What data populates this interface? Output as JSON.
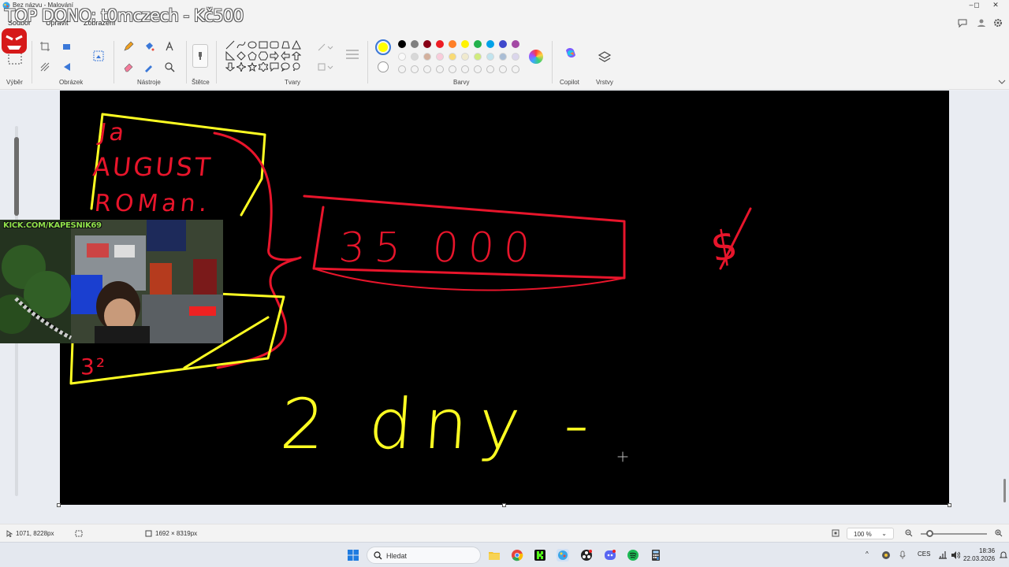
{
  "window": {
    "title": "Bez názvu - Malování",
    "controls": [
      "–",
      "◻",
      "✕"
    ]
  },
  "overlay": {
    "donor_text": "TOP DONO: t0mczech - Kč500",
    "webcam_label": "KICK.COM/KAPESNIK69"
  },
  "menu": {
    "items": [
      "Soubor",
      "Upravit",
      "Zobrazení"
    ]
  },
  "ribbon": {
    "groups": {
      "selection": "Výběr",
      "image": "Obrázek",
      "tools": "Nástroje",
      "brushes": "Štětce",
      "shapes": "Tvary",
      "colors": "Barvy",
      "copilot": "Copilot",
      "layers": "Vrstvy"
    },
    "colors": {
      "current_primary": "#ffff00",
      "row1": [
        "#000000",
        "#7f7f7f",
        "#880015",
        "#ed1c24",
        "#ff7f27",
        "#fff200",
        "#22b14c",
        "#00a2e8",
        "#3f48cc",
        "#a349a4"
      ],
      "row2": [
        "#ffffff",
        "#c3c3c3",
        "#b97a57",
        "#ffaec9",
        "#ffc90e",
        "#efe4b0",
        "#b5e61d",
        "#99d9ea",
        "#7092be",
        "#c8bfe7"
      ]
    }
  },
  "canvas": {
    "background": "#000000",
    "ink_colors": {
      "red": "#e8152b",
      "yellow": "#ffff22"
    },
    "handwriting": {
      "line1": "Ja",
      "line2": "AUGUST",
      "line3": "ROMan.",
      "amount": "35 000",
      "currency": "$",
      "exponent": "3²",
      "bottom": "2 dny -"
    }
  },
  "status": {
    "cursor_position": "1071, 8228px",
    "canvas_size": "1692 × 8319px",
    "zoom": "100 %"
  },
  "taskbar": {
    "search_placeholder": "Hledat",
    "language": "CES",
    "time": "18:36",
    "date": "22.03.2026"
  }
}
